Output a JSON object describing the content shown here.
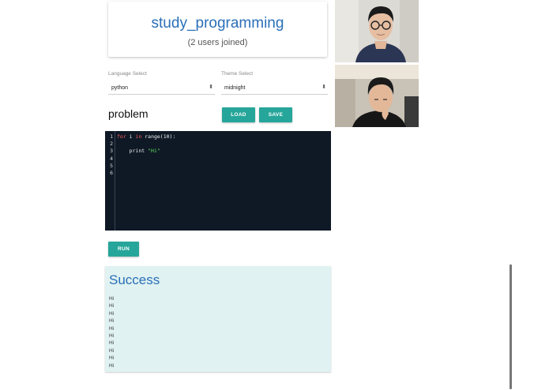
{
  "room": {
    "title": "study_programming",
    "users": "(2 users joined)"
  },
  "language": {
    "label": "Language Select",
    "value": "python"
  },
  "theme": {
    "label": "Theme Select",
    "value": "midnight"
  },
  "problem": {
    "title": "problem",
    "load_label": "LOAD",
    "save_label": "SAVE"
  },
  "editor": {
    "line_numbers": [
      "1",
      "2",
      "3",
      "4",
      "5",
      "6"
    ],
    "line1": {
      "kw1": "for",
      "var": " i ",
      "kw2": "in",
      "rest": " range(10):"
    },
    "line3": {
      "indent": "    print ",
      "str": "\"Hi\""
    }
  },
  "run_label": "RUN",
  "result": {
    "title": "Success",
    "lines": [
      "Hi",
      "Hi",
      "Hi",
      "Hi",
      "Hi",
      "Hi",
      "Hi",
      "Hi",
      "Hi",
      "Hi"
    ]
  },
  "colors": {
    "accent": "#26a69a",
    "title_blue": "#2a6fb8",
    "editor_bg": "#0f1926",
    "result_bg": "#e0f2f1"
  }
}
